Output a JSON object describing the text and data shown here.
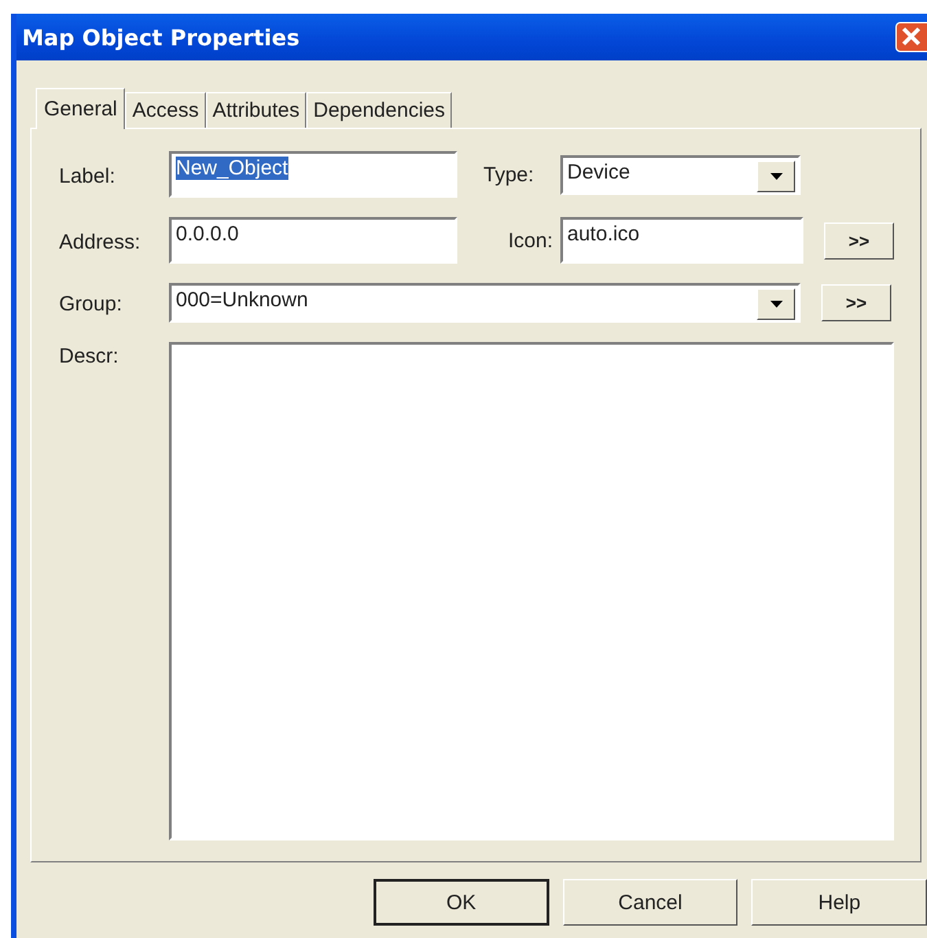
{
  "window": {
    "title": "Map Object Properties"
  },
  "tabs": [
    {
      "label": "General",
      "selected": true
    },
    {
      "label": "Access",
      "selected": false
    },
    {
      "label": "Attributes",
      "selected": false
    },
    {
      "label": "Dependencies",
      "selected": false
    }
  ],
  "form": {
    "label": {
      "caption": "Label:",
      "value": "New_Object",
      "selected": true
    },
    "type": {
      "caption": "Type:",
      "value": "Device"
    },
    "address": {
      "caption": "Address:",
      "value": "0.0.0.0"
    },
    "icon": {
      "caption": "Icon:",
      "value": "auto.ico",
      "button": ">>"
    },
    "group": {
      "caption": "Group:",
      "value": "000=Unknown",
      "button": ">>"
    },
    "descr": {
      "caption": "Descr:"
    }
  },
  "buttons": [
    {
      "label": "OK",
      "default": true
    },
    {
      "label": "Cancel",
      "default": false
    },
    {
      "label": "Help",
      "default": false
    }
  ]
}
